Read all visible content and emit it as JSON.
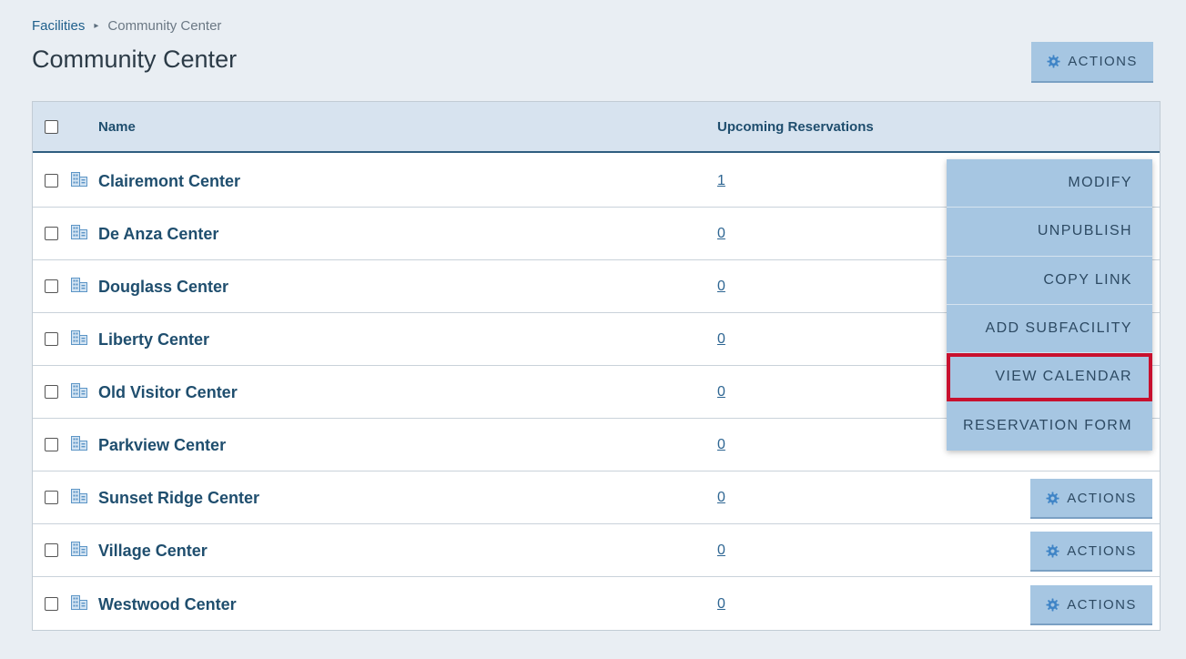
{
  "breadcrumb": {
    "root": "Facilities",
    "separator": "▸",
    "current": "Community Center"
  },
  "page_title": "Community Center",
  "actions_label": "ACTIONS",
  "table": {
    "columns": {
      "name": "Name",
      "upcoming": "Upcoming Reservations"
    },
    "rows": [
      {
        "name": "Clairemont Center",
        "upcoming": "1"
      },
      {
        "name": "De Anza Center",
        "upcoming": "0"
      },
      {
        "name": "Douglass Center",
        "upcoming": "0"
      },
      {
        "name": "Liberty Center",
        "upcoming": "0"
      },
      {
        "name": "Old Visitor Center",
        "upcoming": "0"
      },
      {
        "name": "Parkview Center",
        "upcoming": "0"
      },
      {
        "name": "Sunset Ridge Center",
        "upcoming": "0"
      },
      {
        "name": "Village Center",
        "upcoming": "0"
      },
      {
        "name": "Westwood Center",
        "upcoming": "0"
      }
    ]
  },
  "menu": {
    "items": [
      {
        "label": "MODIFY"
      },
      {
        "label": "UNPUBLISH"
      },
      {
        "label": "COPY LINK"
      },
      {
        "label": "ADD SUBFACILITY"
      },
      {
        "label": "VIEW CALENDAR",
        "highlighted": true
      },
      {
        "label": "RESERVATION FORM"
      }
    ]
  },
  "colors": {
    "background": "#e9eef3",
    "header_bg": "#d7e3ef",
    "button_bg": "#a6c6e2",
    "text_primary": "#1f4e6e",
    "highlight_border": "#c8102e"
  },
  "icons": {
    "actions": "gear-icon",
    "facility": "building-icon"
  }
}
